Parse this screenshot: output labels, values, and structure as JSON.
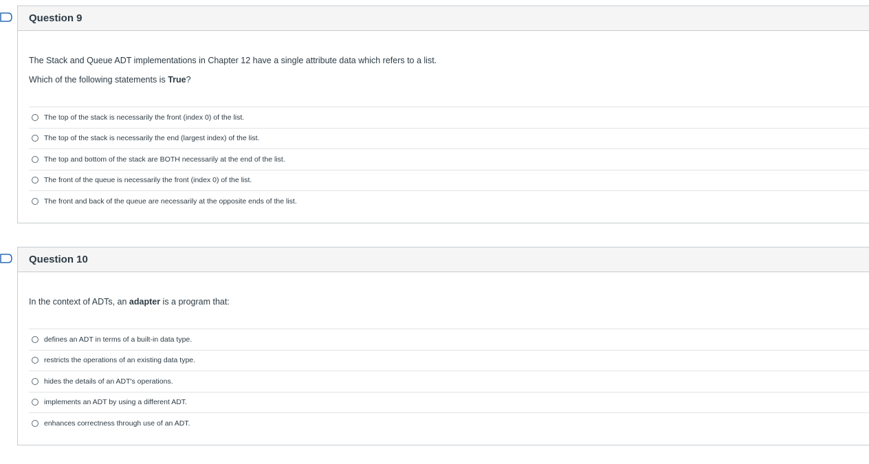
{
  "questions": [
    {
      "title": "Question 9",
      "text_line1": "The Stack and Queue ADT implementations in Chapter 12 have a single attribute data which refers to a list.",
      "text_line2_prefix": "Which of the following statements is ",
      "text_line2_bold": "True",
      "text_line2_suffix": "?",
      "answers": [
        "The top of the stack is necessarily the front (index 0) of the list.",
        "The top of the stack is necessarily the end (largest index) of the list.",
        "The top and bottom of the stack are BOTH necessarily at the end of the list.",
        "The front of the queue is necessarily the front (index 0) of the list.",
        "The front and back of the queue are necessarily at the opposite ends of the list."
      ]
    },
    {
      "title": "Question 10",
      "text_prefix": "In the context of ADTs, an ",
      "text_bold": "adapter",
      "text_suffix": " is a program that:",
      "answers": [
        "defines an ADT in terms of a built-in data type.",
        "restricts the operations of an existing data type.",
        "hides the details of an ADT's operations.",
        "implements an ADT by using a different ADT.",
        "enhances correctness through use of an ADT."
      ]
    }
  ],
  "colors": {
    "flag_outline": "#2d6cb5",
    "border": "#c7cdd1",
    "header_bg": "#f5f5f5",
    "text": "#2d3b45"
  },
  "icons": {
    "flag": "bookmark-flag-icon",
    "radio": "radio-unselected"
  }
}
